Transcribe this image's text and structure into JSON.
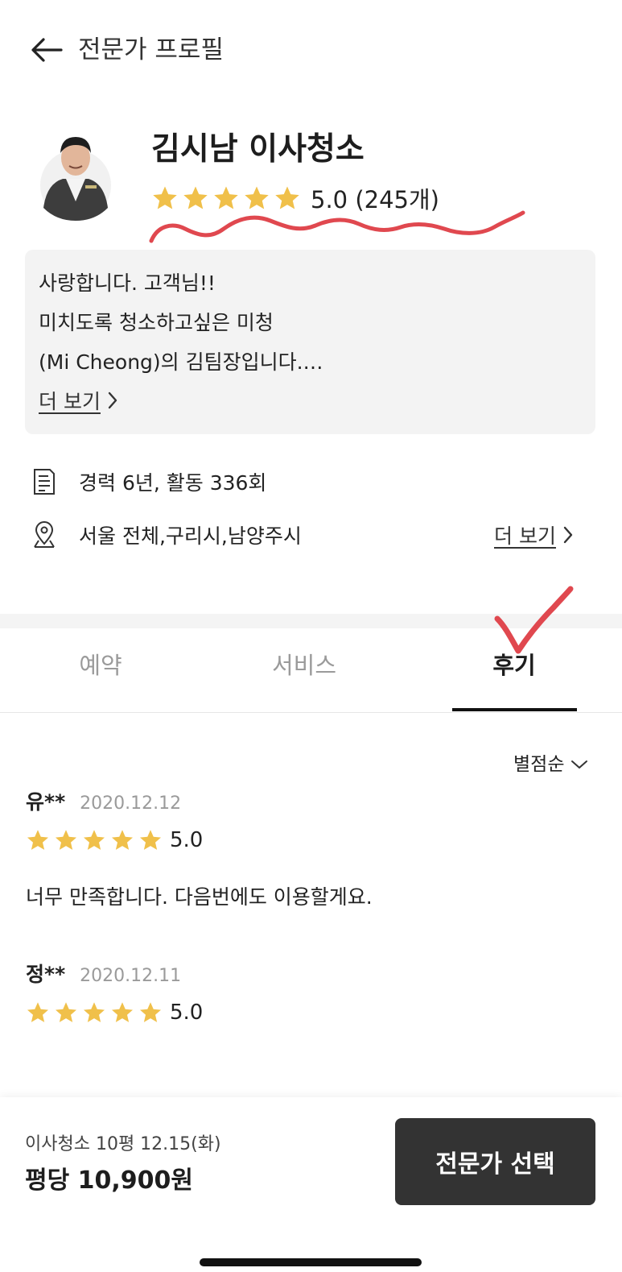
{
  "header": {
    "title": "전문가 프로필"
  },
  "profile": {
    "name": "김시남 이사청소",
    "rating_text": "5.0 (245개)",
    "intro_lines": [
      "사랑합니다. 고객님!!",
      "미치도록 청소하고싶은 미청",
      "(Mi Cheong)의 김팀장입니다.…"
    ],
    "more_label": "더 보기"
  },
  "info": {
    "career": "경력 6년, 활동 336회",
    "area": "서울 전체,구리시,남양주시",
    "more_label": "더 보기"
  },
  "tabs": [
    {
      "label": "예약",
      "active": false
    },
    {
      "label": "서비스",
      "active": false
    },
    {
      "label": "후기",
      "active": true
    }
  ],
  "reviews": {
    "sort_label": "별점순",
    "items": [
      {
        "name": "유**",
        "date": "2020.12.12",
        "score": "5.0",
        "stars": 5,
        "text": "너무 만족합니다. 다음번에도 이용할게요."
      },
      {
        "name": "정**",
        "date": "2020.12.11",
        "score": "5.0",
        "stars": 5,
        "text": ""
      }
    ]
  },
  "bottom": {
    "order_desc": "이사청소 10평 12.15(화)",
    "price": "평당 10,900원",
    "cta_label": "전문가 선택"
  },
  "colors": {
    "star": "#F0C04A",
    "cta_bg": "#333333",
    "annotation_red": "#E0484F"
  }
}
